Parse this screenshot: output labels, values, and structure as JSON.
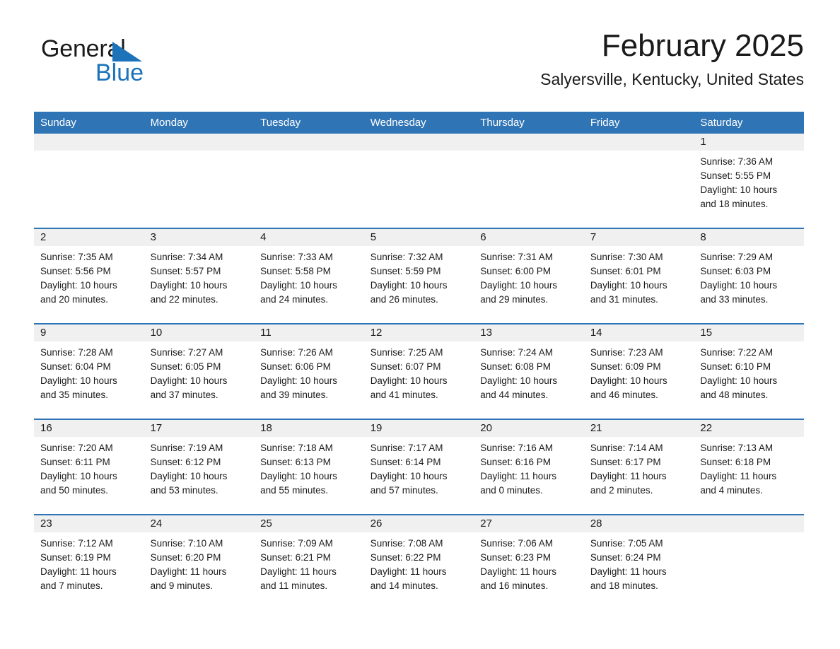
{
  "brand": {
    "word1": "General",
    "word2": "Blue",
    "triangle_color": "#1c73ba"
  },
  "header": {
    "title": "February 2025",
    "subtitle": "Salyersville, Kentucky, United States",
    "header_bg": "#2f74b5",
    "daynum_bg": "#f0f0f0"
  },
  "weekday_headers": [
    "Sunday",
    "Monday",
    "Tuesday",
    "Wednesday",
    "Thursday",
    "Friday",
    "Saturday"
  ],
  "labels": {
    "sunrise_prefix": "Sunrise:",
    "sunset_prefix": "Sunset:",
    "daylight_prefix": "Daylight:"
  },
  "weeks": [
    [
      {
        "day": "",
        "sunrise": "",
        "sunset": "",
        "daylight_line1": "",
        "daylight_line2": ""
      },
      {
        "day": "",
        "sunrise": "",
        "sunset": "",
        "daylight_line1": "",
        "daylight_line2": ""
      },
      {
        "day": "",
        "sunrise": "",
        "sunset": "",
        "daylight_line1": "",
        "daylight_line2": ""
      },
      {
        "day": "",
        "sunrise": "",
        "sunset": "",
        "daylight_line1": "",
        "daylight_line2": ""
      },
      {
        "day": "",
        "sunrise": "",
        "sunset": "",
        "daylight_line1": "",
        "daylight_line2": ""
      },
      {
        "day": "",
        "sunrise": "",
        "sunset": "",
        "daylight_line1": "",
        "daylight_line2": ""
      },
      {
        "day": "1",
        "sunrise": "Sunrise: 7:36 AM",
        "sunset": "Sunset: 5:55 PM",
        "daylight_line1": "Daylight: 10 hours",
        "daylight_line2": "and 18 minutes."
      }
    ],
    [
      {
        "day": "2",
        "sunrise": "Sunrise: 7:35 AM",
        "sunset": "Sunset: 5:56 PM",
        "daylight_line1": "Daylight: 10 hours",
        "daylight_line2": "and 20 minutes."
      },
      {
        "day": "3",
        "sunrise": "Sunrise: 7:34 AM",
        "sunset": "Sunset: 5:57 PM",
        "daylight_line1": "Daylight: 10 hours",
        "daylight_line2": "and 22 minutes."
      },
      {
        "day": "4",
        "sunrise": "Sunrise: 7:33 AM",
        "sunset": "Sunset: 5:58 PM",
        "daylight_line1": "Daylight: 10 hours",
        "daylight_line2": "and 24 minutes."
      },
      {
        "day": "5",
        "sunrise": "Sunrise: 7:32 AM",
        "sunset": "Sunset: 5:59 PM",
        "daylight_line1": "Daylight: 10 hours",
        "daylight_line2": "and 26 minutes."
      },
      {
        "day": "6",
        "sunrise": "Sunrise: 7:31 AM",
        "sunset": "Sunset: 6:00 PM",
        "daylight_line1": "Daylight: 10 hours",
        "daylight_line2": "and 29 minutes."
      },
      {
        "day": "7",
        "sunrise": "Sunrise: 7:30 AM",
        "sunset": "Sunset: 6:01 PM",
        "daylight_line1": "Daylight: 10 hours",
        "daylight_line2": "and 31 minutes."
      },
      {
        "day": "8",
        "sunrise": "Sunrise: 7:29 AM",
        "sunset": "Sunset: 6:03 PM",
        "daylight_line1": "Daylight: 10 hours",
        "daylight_line2": "and 33 minutes."
      }
    ],
    [
      {
        "day": "9",
        "sunrise": "Sunrise: 7:28 AM",
        "sunset": "Sunset: 6:04 PM",
        "daylight_line1": "Daylight: 10 hours",
        "daylight_line2": "and 35 minutes."
      },
      {
        "day": "10",
        "sunrise": "Sunrise: 7:27 AM",
        "sunset": "Sunset: 6:05 PM",
        "daylight_line1": "Daylight: 10 hours",
        "daylight_line2": "and 37 minutes."
      },
      {
        "day": "11",
        "sunrise": "Sunrise: 7:26 AM",
        "sunset": "Sunset: 6:06 PM",
        "daylight_line1": "Daylight: 10 hours",
        "daylight_line2": "and 39 minutes."
      },
      {
        "day": "12",
        "sunrise": "Sunrise: 7:25 AM",
        "sunset": "Sunset: 6:07 PM",
        "daylight_line1": "Daylight: 10 hours",
        "daylight_line2": "and 41 minutes."
      },
      {
        "day": "13",
        "sunrise": "Sunrise: 7:24 AM",
        "sunset": "Sunset: 6:08 PM",
        "daylight_line1": "Daylight: 10 hours",
        "daylight_line2": "and 44 minutes."
      },
      {
        "day": "14",
        "sunrise": "Sunrise: 7:23 AM",
        "sunset": "Sunset: 6:09 PM",
        "daylight_line1": "Daylight: 10 hours",
        "daylight_line2": "and 46 minutes."
      },
      {
        "day": "15",
        "sunrise": "Sunrise: 7:22 AM",
        "sunset": "Sunset: 6:10 PM",
        "daylight_line1": "Daylight: 10 hours",
        "daylight_line2": "and 48 minutes."
      }
    ],
    [
      {
        "day": "16",
        "sunrise": "Sunrise: 7:20 AM",
        "sunset": "Sunset: 6:11 PM",
        "daylight_line1": "Daylight: 10 hours",
        "daylight_line2": "and 50 minutes."
      },
      {
        "day": "17",
        "sunrise": "Sunrise: 7:19 AM",
        "sunset": "Sunset: 6:12 PM",
        "daylight_line1": "Daylight: 10 hours",
        "daylight_line2": "and 53 minutes."
      },
      {
        "day": "18",
        "sunrise": "Sunrise: 7:18 AM",
        "sunset": "Sunset: 6:13 PM",
        "daylight_line1": "Daylight: 10 hours",
        "daylight_line2": "and 55 minutes."
      },
      {
        "day": "19",
        "sunrise": "Sunrise: 7:17 AM",
        "sunset": "Sunset: 6:14 PM",
        "daylight_line1": "Daylight: 10 hours",
        "daylight_line2": "and 57 minutes."
      },
      {
        "day": "20",
        "sunrise": "Sunrise: 7:16 AM",
        "sunset": "Sunset: 6:16 PM",
        "daylight_line1": "Daylight: 11 hours",
        "daylight_line2": "and 0 minutes."
      },
      {
        "day": "21",
        "sunrise": "Sunrise: 7:14 AM",
        "sunset": "Sunset: 6:17 PM",
        "daylight_line1": "Daylight: 11 hours",
        "daylight_line2": "and 2 minutes."
      },
      {
        "day": "22",
        "sunrise": "Sunrise: 7:13 AM",
        "sunset": "Sunset: 6:18 PM",
        "daylight_line1": "Daylight: 11 hours",
        "daylight_line2": "and 4 minutes."
      }
    ],
    [
      {
        "day": "23",
        "sunrise": "Sunrise: 7:12 AM",
        "sunset": "Sunset: 6:19 PM",
        "daylight_line1": "Daylight: 11 hours",
        "daylight_line2": "and 7 minutes."
      },
      {
        "day": "24",
        "sunrise": "Sunrise: 7:10 AM",
        "sunset": "Sunset: 6:20 PM",
        "daylight_line1": "Daylight: 11 hours",
        "daylight_line2": "and 9 minutes."
      },
      {
        "day": "25",
        "sunrise": "Sunrise: 7:09 AM",
        "sunset": "Sunset: 6:21 PM",
        "daylight_line1": "Daylight: 11 hours",
        "daylight_line2": "and 11 minutes."
      },
      {
        "day": "26",
        "sunrise": "Sunrise: 7:08 AM",
        "sunset": "Sunset: 6:22 PM",
        "daylight_line1": "Daylight: 11 hours",
        "daylight_line2": "and 14 minutes."
      },
      {
        "day": "27",
        "sunrise": "Sunrise: 7:06 AM",
        "sunset": "Sunset: 6:23 PM",
        "daylight_line1": "Daylight: 11 hours",
        "daylight_line2": "and 16 minutes."
      },
      {
        "day": "28",
        "sunrise": "Sunrise: 7:05 AM",
        "sunset": "Sunset: 6:24 PM",
        "daylight_line1": "Daylight: 11 hours",
        "daylight_line2": "and 18 minutes."
      },
      {
        "day": "",
        "sunrise": "",
        "sunset": "",
        "daylight_line1": "",
        "daylight_line2": ""
      }
    ]
  ]
}
